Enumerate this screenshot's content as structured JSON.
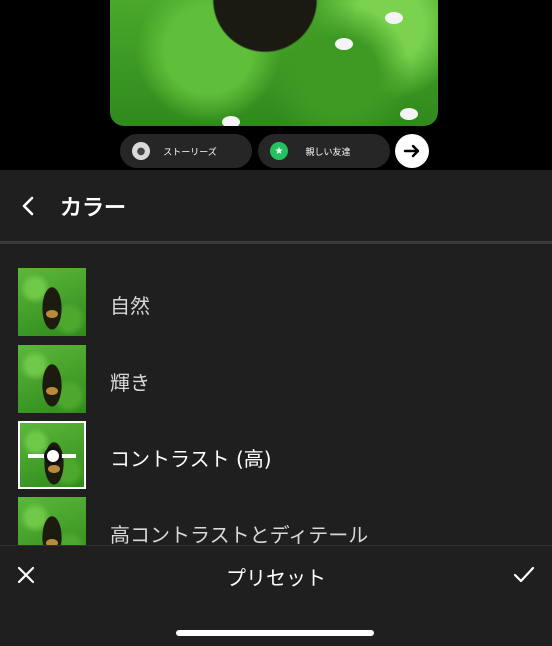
{
  "share": {
    "stories_label": "ストーリーズ",
    "close_friends_label": "親しい友達",
    "colors": {
      "close_friends_badge": "#22c35e",
      "pill_bg": "#262626"
    }
  },
  "panel": {
    "title": "カラー",
    "filters": [
      {
        "label": "自然",
        "selected": false
      },
      {
        "label": "輝き",
        "selected": false
      },
      {
        "label": "コントラスト (高)",
        "selected": true
      },
      {
        "label": "高コントラストとディテール",
        "selected": false
      }
    ]
  },
  "footer": {
    "title": "プリセット",
    "cancel_icon": "close-icon",
    "confirm_icon": "check-icon"
  }
}
